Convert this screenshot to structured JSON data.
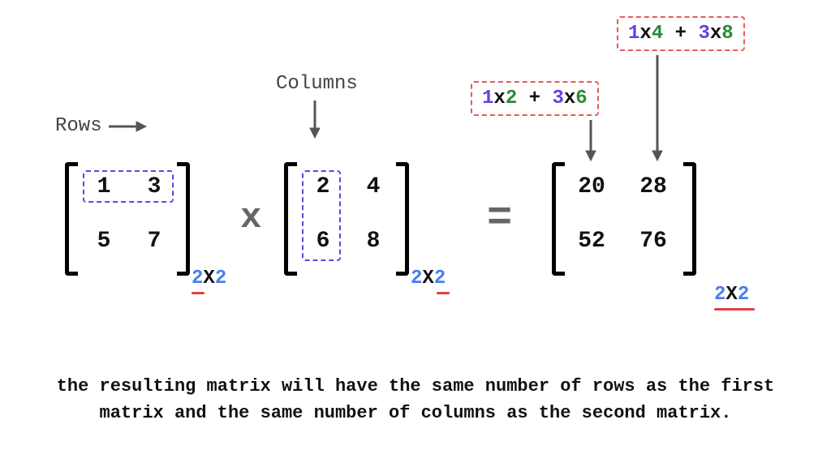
{
  "labels": {
    "rows": "Rows",
    "columns": "Columns"
  },
  "matrixA": {
    "r1c1": "1",
    "r1c2": "3",
    "r2c1": "5",
    "r2c2": "7",
    "dim_a": "2",
    "dim_x": "X",
    "dim_b": "2"
  },
  "matrixB": {
    "r1c1": "2",
    "r1c2": "4",
    "r2c1": "6",
    "r2c2": "8",
    "dim_a": "2",
    "dim_x": "X",
    "dim_b": "2"
  },
  "matrixC": {
    "r1c1": "20",
    "r1c2": "28",
    "r2c1": "52",
    "r2c2": "76",
    "dim_a": "2",
    "dim_x": "X",
    "dim_b": "2"
  },
  "ops": {
    "times": "x",
    "equals": "="
  },
  "calc1": {
    "a": "1",
    "x1": "x",
    "b": "2",
    "plus": " + ",
    "c": "3",
    "x2": "x",
    "d": "6"
  },
  "calc2": {
    "a": "1",
    "x1": "x",
    "b": "4",
    "plus": " + ",
    "c": "3",
    "x2": "x",
    "d": "8"
  },
  "caption_line1": "the resulting matrix will have the same number of rows as the first",
  "caption_line2": "matrix and the same number of columns as the second matrix.",
  "chart_data": {
    "type": "table",
    "description": "2x2 matrix multiplication example",
    "A": [
      [
        1,
        3
      ],
      [
        5,
        7
      ]
    ],
    "B": [
      [
        2,
        4
      ],
      [
        6,
        8
      ]
    ],
    "C": [
      [
        20,
        28
      ],
      [
        52,
        76
      ]
    ],
    "dims": {
      "A": "2x2",
      "B": "2x2",
      "C": "2x2"
    },
    "highlighted_row_A": [
      1,
      3
    ],
    "highlighted_col_B": [
      2,
      6
    ],
    "computations": {
      "C[0][0]": "1x2 + 3x6",
      "C[0][1]": "1x4 + 3x8"
    }
  }
}
